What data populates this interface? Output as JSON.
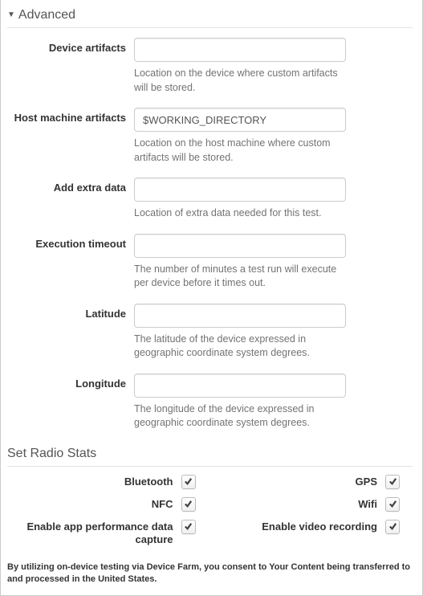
{
  "advanced": {
    "title": "Advanced",
    "fields": {
      "device_artifacts": {
        "label": "Device artifacts",
        "value": "",
        "help": "Location on the device where custom artifacts will be stored."
      },
      "host_machine_artifacts": {
        "label": "Host machine artifacts",
        "value": "$WORKING_DIRECTORY",
        "help": "Location on the host machine where custom artifacts will be stored."
      },
      "add_extra_data": {
        "label": "Add extra data",
        "value": "",
        "help": "Location of extra data needed for this test."
      },
      "execution_timeout": {
        "label": "Execution timeout",
        "value": "",
        "help": "The number of minutes a test run will execute per device before it times out."
      },
      "latitude": {
        "label": "Latitude",
        "value": "",
        "help": "The latitude of the device expressed in geographic coordinate system degrees."
      },
      "longitude": {
        "label": "Longitude",
        "value": "",
        "help": "The longitude of the device expressed in geographic coordinate system degrees."
      }
    }
  },
  "radio": {
    "title": "Set Radio Stats",
    "items": {
      "bluetooth": {
        "label": "Bluetooth",
        "checked": true
      },
      "gps": {
        "label": "GPS",
        "checked": true
      },
      "nfc": {
        "label": "NFC",
        "checked": true
      },
      "wifi": {
        "label": "Wifi",
        "checked": true
      },
      "app_perf": {
        "label": "Enable app performance data capture",
        "checked": true
      },
      "video_rec": {
        "label": "Enable video recording",
        "checked": true
      }
    }
  },
  "consent_text": "By utilizing on-device testing via Device Farm, you consent to Your Content being transferred to and processed in the United States."
}
